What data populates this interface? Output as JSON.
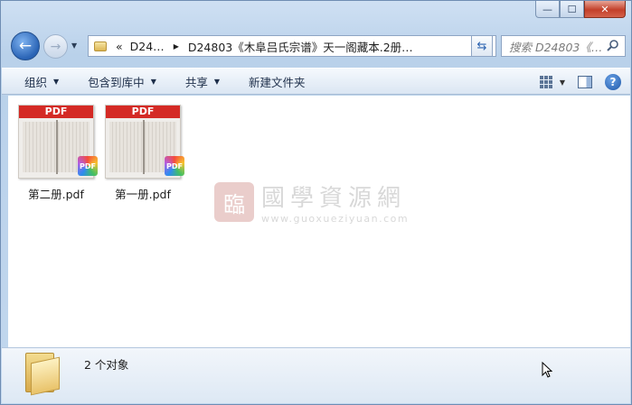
{
  "window": {
    "minimize_glyph": "—",
    "maximize_glyph": "☐",
    "close_glyph": "✕"
  },
  "nav": {
    "back_glyph": "←",
    "forward_glyph": "→"
  },
  "address": {
    "overflow": "«",
    "segments": [
      "D24…",
      "D24803《木阜吕氏宗谱》天一阁藏本.2册…"
    ]
  },
  "search": {
    "placeholder": "搜索 D24803《…"
  },
  "toolbar": {
    "organize": "组织",
    "include_in_library": "包含到库中",
    "share": "共享",
    "new_folder": "新建文件夹",
    "help": "?"
  },
  "files": [
    {
      "name": "第二册.pdf",
      "banner": "PDF",
      "badge": "PDF"
    },
    {
      "name": "第一册.pdf",
      "banner": "PDF",
      "badge": "PDF"
    }
  ],
  "watermark": {
    "seal": "臨",
    "title": "國學資源網",
    "url": "www.guoxueziyuan.com"
  },
  "status": {
    "count": "2 个对象"
  },
  "colors": {
    "pdf_banner": "#d42a25",
    "close_button": "#c3402a"
  }
}
